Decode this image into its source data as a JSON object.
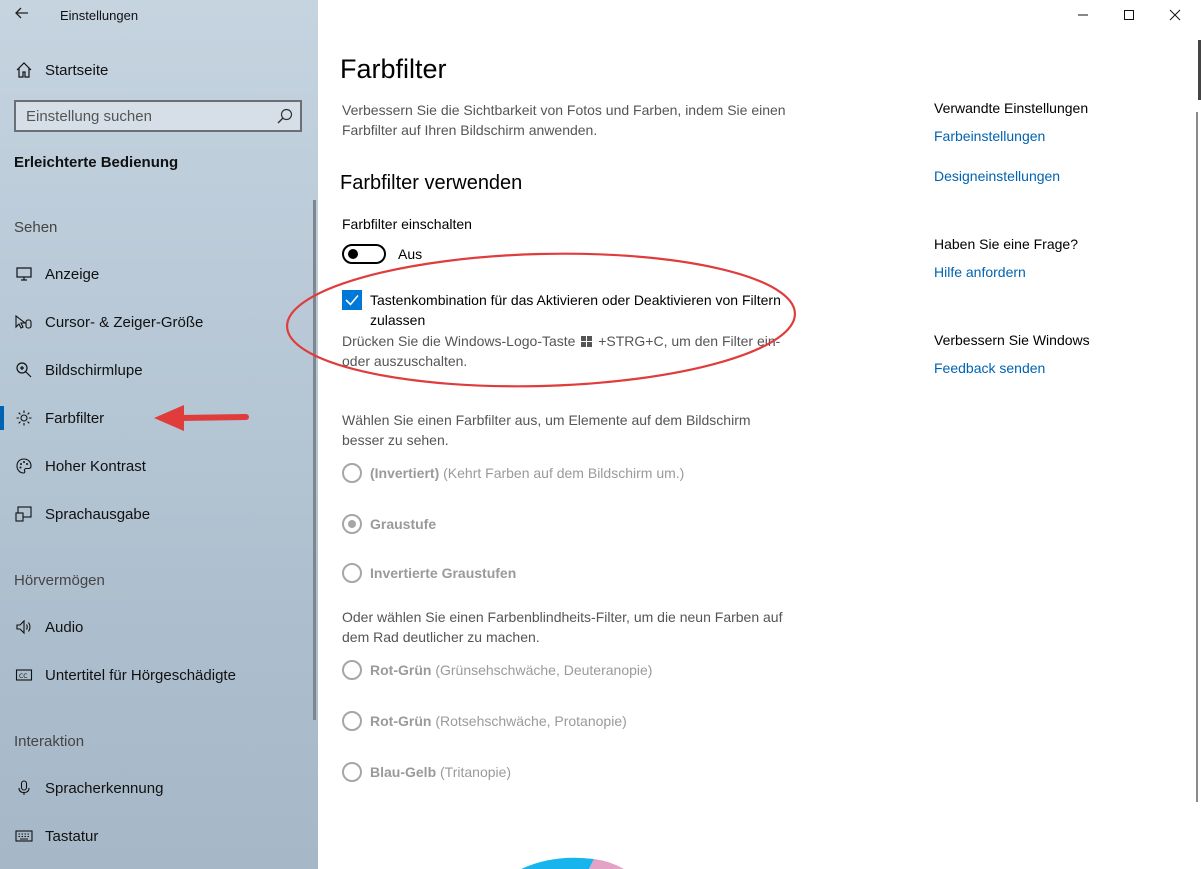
{
  "window": {
    "app_title": "Einstellungen",
    "back_icon": "back-arrow-icon",
    "controls": [
      "minimize-icon",
      "maximize-icon",
      "close-icon"
    ]
  },
  "sidebar": {
    "home_label": "Startseite",
    "search_placeholder": "Einstellung suchen",
    "section_heading": "Erleichterte Bedienung",
    "groups": {
      "sehen": "Sehen",
      "hoervermoegen": "Hörvermögen",
      "interaktion": "Interaktion"
    },
    "items": [
      {
        "label": "Anzeige",
        "icon": "monitor-icon"
      },
      {
        "label": "Cursor- & Zeiger-Größe",
        "icon": "cursor-icon"
      },
      {
        "label": "Bildschirmlupe",
        "icon": "magnifier-icon"
      },
      {
        "label": "Farbfilter",
        "icon": "brightness-icon",
        "selected": true
      },
      {
        "label": "Hoher Kontrast",
        "icon": "palette-icon"
      },
      {
        "label": "Sprachausgabe",
        "icon": "narrator-icon"
      },
      {
        "label": "Audio",
        "icon": "speaker-icon"
      },
      {
        "label": "Untertitel für Hörgeschädigte",
        "icon": "captions-icon"
      },
      {
        "label": "Spracherkennung",
        "icon": "microphone-icon"
      },
      {
        "label": "Tastatur",
        "icon": "keyboard-icon"
      }
    ],
    "accent_color": "#0063b1"
  },
  "main": {
    "title": "Farbfilter",
    "description": "Verbessern Sie die Sichtbarkeit von Fotos und Farben, indem Sie einen Farbfilter auf Ihren Bildschirm anwenden.",
    "subtitle": "Farbfilter verwenden",
    "toggle_label": "Farbfilter einschalten",
    "toggle_state": "Aus",
    "toggle_on": false,
    "shortcut_checkbox_label": "Tastenkombination für das Aktivieren oder Deaktivieren von Filtern zulassen",
    "shortcut_checked": true,
    "shortcut_hint_before": "Drücken Sie die Windows-Logo-Taste",
    "shortcut_hint_after": "+STRG+C, um den Filter ein- oder auszuschalten.",
    "choose_filter_text": "Wählen Sie einen Farbfilter aus, um Elemente auf dem Bildschirm besser zu sehen.",
    "filters": [
      {
        "name": "(Invertiert)",
        "detail": "(Kehrt Farben auf dem Bildschirm um.)",
        "selected": false
      },
      {
        "name": "Graustufe",
        "detail": "",
        "selected": true
      },
      {
        "name": "Invertierte Graustufen",
        "detail": "",
        "selected": false
      }
    ],
    "choose_colorblind_text": "Oder wählen Sie einen Farbenblindheits-Filter, um die neun Farben auf dem Rad deutlicher zu machen.",
    "colorblind_filters": [
      {
        "name": "Rot-Grün",
        "detail": "(Grünsehschwäche, Deuteranopie)",
        "selected": false
      },
      {
        "name": "Rot-Grün",
        "detail": "(Rotsehschwäche, Protanopie)",
        "selected": false
      },
      {
        "name": "Blau-Gelb",
        "detail": "(Tritanopie)",
        "selected": false
      }
    ]
  },
  "related": {
    "heading": "Verwandte Einstellungen",
    "link1": "Farbeinstellungen",
    "link2": "Designeinstellungen",
    "question_heading": "Haben Sie eine Frage?",
    "help_link": "Hilfe anfordern",
    "improve_heading": "Verbessern Sie Windows",
    "feedback_link": "Feedback senden",
    "link_color": "#0063b1"
  },
  "annotations": {
    "ellipse_color": "#e03c3c",
    "arrow_color": "#e03c3c"
  }
}
